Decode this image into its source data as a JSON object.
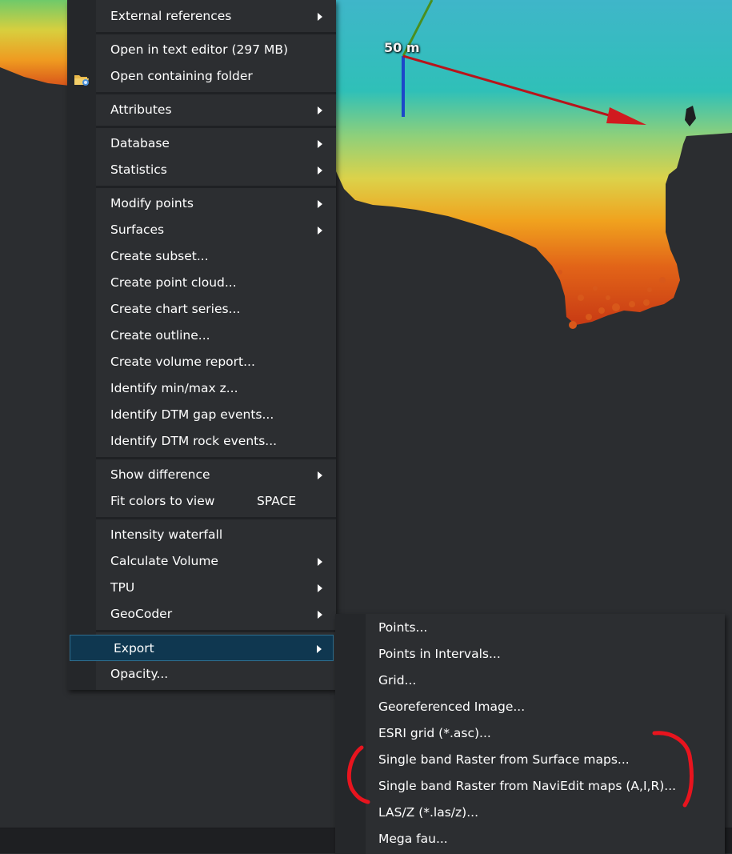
{
  "viewport": {
    "scale_label": "50 m",
    "colors": {
      "background": "#2b2d30",
      "axis_x": "#b8141b",
      "axis_y": "#4a8f1f",
      "axis_z": "#1c47c9",
      "highlight": "#0f3750",
      "annotation": "#e8141e"
    }
  },
  "context_menu": {
    "items": [
      {
        "label": "External references",
        "submenu": true
      },
      {
        "label": "Open in text editor (297 MB)",
        "submenu": false
      },
      {
        "label": "Open containing folder",
        "submenu": false,
        "icon": "folder-icon"
      },
      {
        "label": "Attributes",
        "submenu": true
      },
      {
        "label": "Database",
        "submenu": true
      },
      {
        "label": "Statistics",
        "submenu": true
      },
      {
        "label": "Modify points",
        "submenu": true
      },
      {
        "label": "Surfaces",
        "submenu": true
      },
      {
        "label": "Create subset...",
        "submenu": false
      },
      {
        "label": "Create point cloud...",
        "submenu": false
      },
      {
        "label": "Create chart series...",
        "submenu": false
      },
      {
        "label": "Create outline...",
        "submenu": false
      },
      {
        "label": "Create volume report...",
        "submenu": false
      },
      {
        "label": "Identify min/max z...",
        "submenu": false
      },
      {
        "label": "Identify DTM gap events...",
        "submenu": false
      },
      {
        "label": "Identify DTM rock events...",
        "submenu": false
      },
      {
        "label": "Show difference",
        "submenu": true
      },
      {
        "label": "Fit colors to view",
        "submenu": false,
        "shortcut": "SPACE"
      },
      {
        "label": "Intensity waterfall",
        "submenu": false
      },
      {
        "label": "Calculate Volume",
        "submenu": true
      },
      {
        "label": "TPU",
        "submenu": true
      },
      {
        "label": "GeoCoder",
        "submenu": true
      },
      {
        "label": "Export",
        "submenu": true,
        "highlighted": true
      },
      {
        "label": "Opacity...",
        "submenu": false
      }
    ]
  },
  "export_submenu": {
    "items": [
      {
        "label": "Points..."
      },
      {
        "label": "Points in Intervals..."
      },
      {
        "label": "Grid..."
      },
      {
        "label": "Georeferenced Image..."
      },
      {
        "label": "ESRI grid (*.asc)..."
      },
      {
        "label": "Single band Raster from Surface maps..."
      },
      {
        "label": "Single band Raster from NaviEdit maps (A,I,R)..."
      },
      {
        "label": "LAS/Z (*.las/z)..."
      },
      {
        "label": "Mega fau..."
      }
    ]
  }
}
